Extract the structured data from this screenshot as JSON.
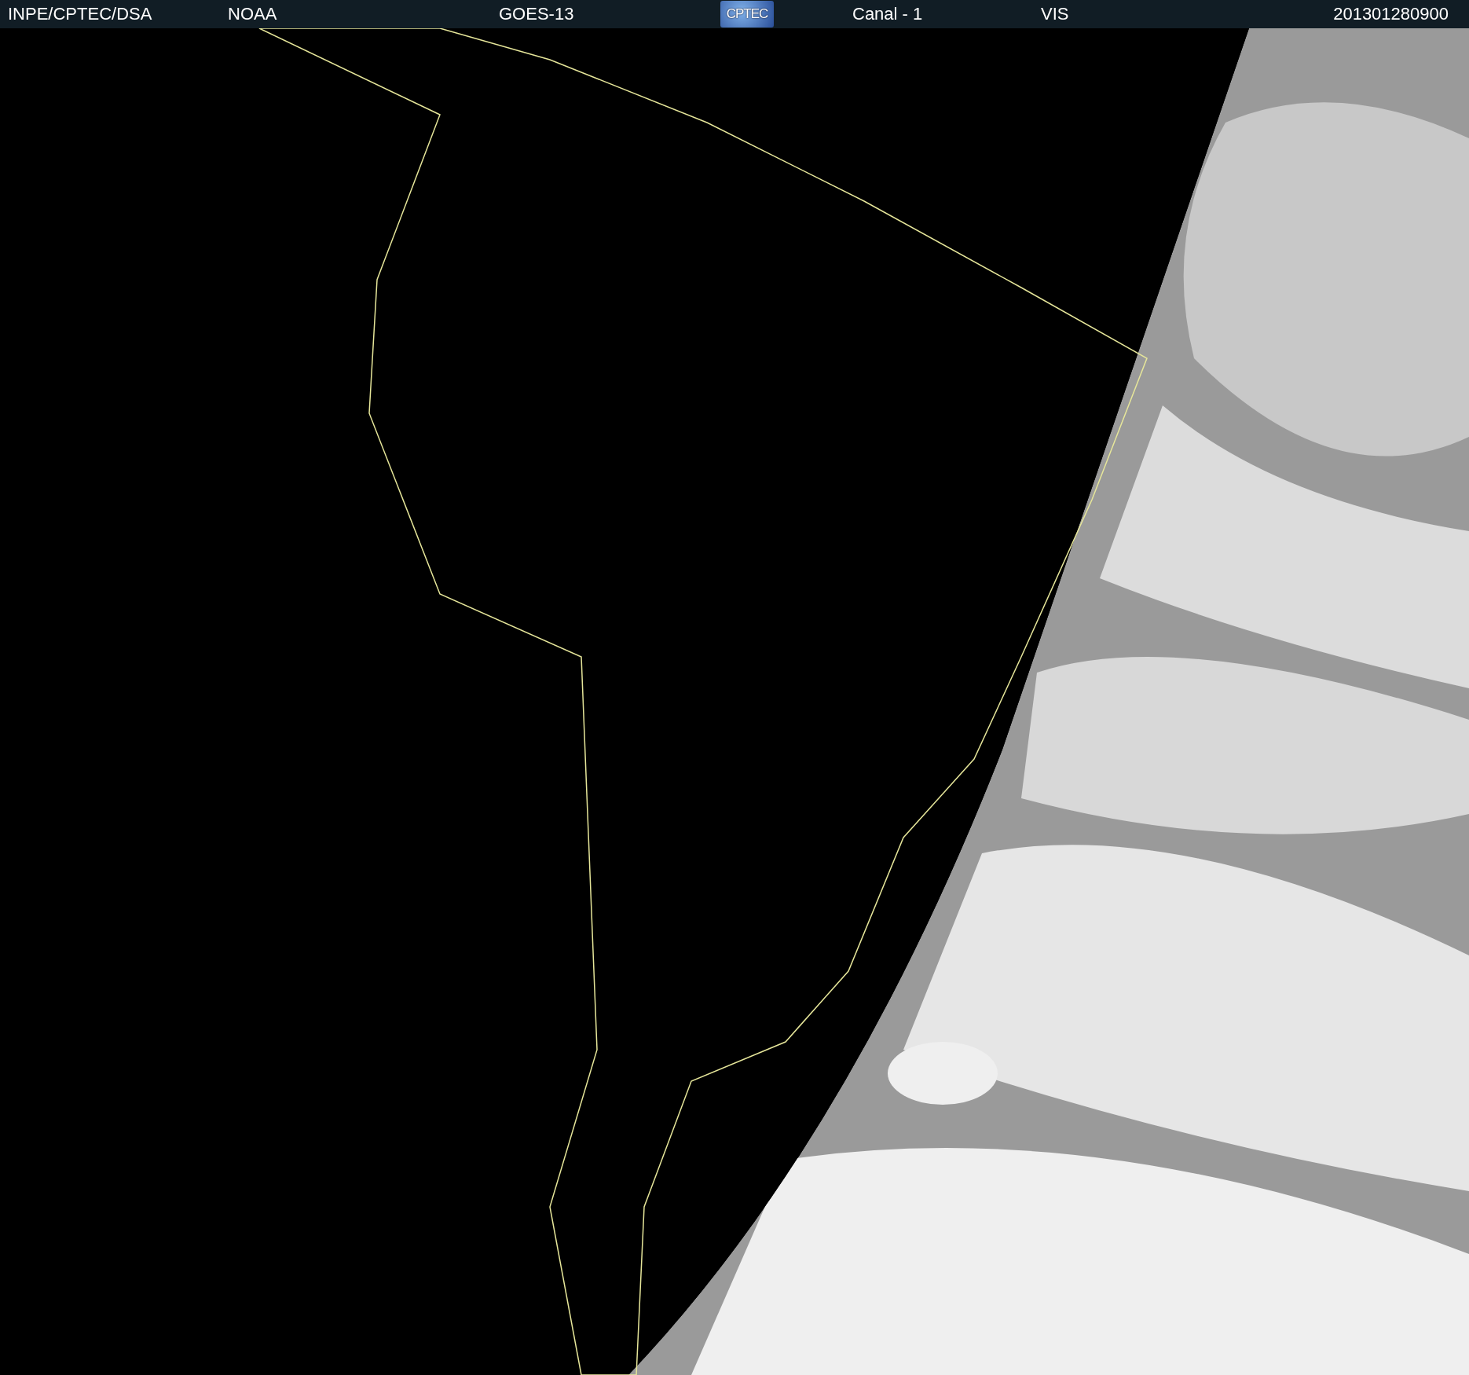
{
  "header": {
    "labels": [
      {
        "text": "INPE/CPTEC/DSA"
      },
      {
        "text": "NOAA"
      },
      {
        "text": "GOES-13"
      },
      {
        "text": "Canal - 1"
      },
      {
        "text": "VIS"
      },
      {
        "text": "201301280900"
      }
    ],
    "logo": "CPTEC"
  }
}
